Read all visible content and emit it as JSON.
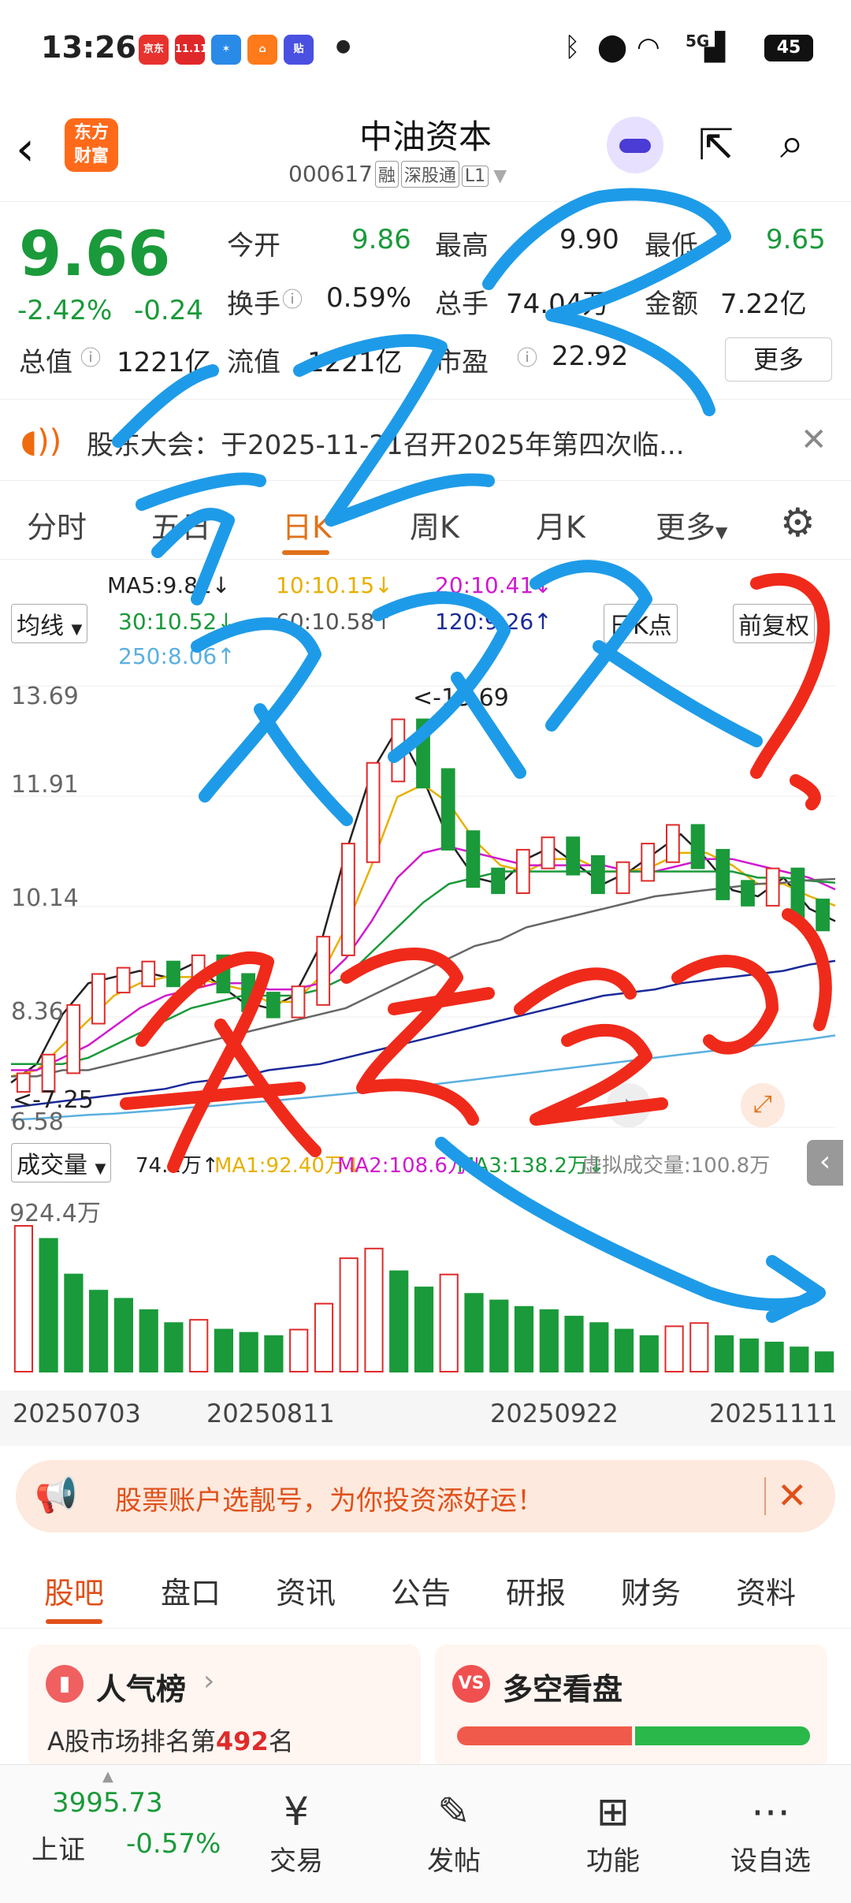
{
  "status_bar": {
    "time": "13:26",
    "apps": [
      "京东秒送",
      "11.11",
      "星",
      "淘",
      "贴"
    ],
    "network": "5G",
    "battery": "45"
  },
  "header": {
    "stock_name": "中油资本",
    "stock_code": "000617",
    "tags": [
      "融",
      "深股通",
      "L1"
    ],
    "logo_text_1": "东方",
    "logo_text_2": "财富"
  },
  "quote": {
    "price": "9.66",
    "pct_change": "-2.42%",
    "change": "-0.24",
    "open_label": "今开",
    "open": "9.86",
    "high_label": "最高",
    "high": "9.90",
    "low_label": "最低",
    "low": "9.65",
    "turnover_label": "换手",
    "turnover": "0.59%",
    "volume_label": "总手",
    "volume": "74.04万",
    "amount_label": "金额",
    "amount": "7.22亿",
    "mktcap_label": "总值",
    "mktcap": "1221亿",
    "float_label": "流值",
    "float_cap": "1221亿",
    "pe_label": "市盈",
    "pe": "22.92",
    "more_label": "更多"
  },
  "notice": {
    "text": "股东大会：于2025-11-21召开2025年第四次临..."
  },
  "k_tabs": [
    "分时",
    "五日",
    "日K",
    "周K",
    "月K",
    "更多"
  ],
  "k_tab_active": 2,
  "indicators": {
    "mode": "均线",
    "ma5": "MA5:9.82↓",
    "ma10": "10:10.15↓",
    "ma20": "20:10.41↓",
    "ma30": "30:10.52↓",
    "ma60": "60:10.58↑",
    "ma120": "120:9.26↑",
    "ma250": "250:8.06↑",
    "period": "日K点",
    "adjust": "前复权"
  },
  "chart_data": {
    "type": "line",
    "title": "",
    "ylim": [
      6.58,
      13.69
    ],
    "y_ticks": [
      "13.69",
      "11.91",
      "10.14",
      "8.36",
      "6.58"
    ],
    "max_marker": "<-13.69",
    "min_marker": "<-7.25",
    "x_labels": [
      "20250703",
      "20250811",
      "20250922",
      "20251111"
    ],
    "series": [
      {
        "name": "MA5",
        "values": [
          7.3,
          7.6,
          8.4,
          8.9,
          9.0,
          9.1,
          9.0,
          9.2,
          8.9,
          8.6,
          8.5,
          8.7,
          9.5,
          11.0,
          12.3,
          13.0,
          12.2,
          11.2,
          10.6,
          10.5,
          10.9,
          11.1,
          10.8,
          10.5,
          10.7,
          11.0,
          11.3,
          10.9,
          10.4,
          10.3,
          10.6,
          10.1,
          9.9
        ]
      },
      {
        "name": "MA10",
        "values": [
          7.4,
          7.5,
          7.9,
          8.3,
          8.7,
          8.9,
          9.0,
          9.0,
          8.9,
          8.8,
          8.6,
          8.6,
          9.0,
          9.8,
          10.8,
          11.9,
          12.1,
          11.8,
          11.2,
          10.8,
          10.7,
          10.9,
          10.9,
          10.7,
          10.7,
          10.8,
          11.0,
          11.0,
          10.8,
          10.5,
          10.5,
          10.3,
          10.15
        ]
      },
      {
        "name": "MA20",
        "values": [
          7.5,
          7.5,
          7.7,
          7.9,
          8.2,
          8.5,
          8.7,
          8.8,
          8.9,
          8.9,
          8.8,
          8.8,
          8.9,
          9.3,
          9.9,
          10.6,
          11.0,
          11.1,
          11.0,
          10.9,
          10.8,
          10.8,
          10.8,
          10.8,
          10.7,
          10.7,
          10.8,
          10.9,
          10.9,
          10.8,
          10.7,
          10.6,
          10.41
        ]
      },
      {
        "name": "MA30",
        "values": [
          7.6,
          7.6,
          7.6,
          7.7,
          7.9,
          8.1,
          8.3,
          8.5,
          8.6,
          8.7,
          8.7,
          8.7,
          8.8,
          9.0,
          9.4,
          9.8,
          10.2,
          10.5,
          10.6,
          10.7,
          10.7,
          10.7,
          10.7,
          10.7,
          10.7,
          10.7,
          10.7,
          10.7,
          10.7,
          10.6,
          10.6,
          10.55,
          10.52
        ]
      },
      {
        "name": "MA60",
        "values": [
          7.4,
          7.4,
          7.5,
          7.5,
          7.6,
          7.7,
          7.8,
          7.9,
          8.0,
          8.1,
          8.2,
          8.3,
          8.4,
          8.5,
          8.7,
          8.9,
          9.1,
          9.3,
          9.5,
          9.6,
          9.8,
          9.9,
          10.0,
          10.1,
          10.2,
          10.3,
          10.35,
          10.4,
          10.45,
          10.5,
          10.52,
          10.56,
          10.58
        ]
      },
      {
        "name": "MA120",
        "values": [
          6.9,
          6.95,
          7.0,
          7.05,
          7.1,
          7.15,
          7.2,
          7.3,
          7.35,
          7.4,
          7.5,
          7.55,
          7.6,
          7.7,
          7.8,
          7.9,
          8.0,
          8.1,
          8.2,
          8.3,
          8.4,
          8.5,
          8.6,
          8.7,
          8.75,
          8.8,
          8.9,
          8.95,
          9.0,
          9.05,
          9.1,
          9.2,
          9.26
        ]
      },
      {
        "name": "MA250",
        "values": [
          6.7,
          6.72,
          6.75,
          6.78,
          6.8,
          6.83,
          6.86,
          6.9,
          6.93,
          6.97,
          7.0,
          7.04,
          7.08,
          7.12,
          7.16,
          7.2,
          7.25,
          7.3,
          7.35,
          7.4,
          7.45,
          7.5,
          7.55,
          7.6,
          7.65,
          7.7,
          7.75,
          7.8,
          7.85,
          7.9,
          7.95,
          8.0,
          8.06
        ]
      }
    ],
    "volume": {
      "max_label": "924.4万",
      "label": "成交量",
      "current": "74.1万↑",
      "ma1": "MA1:92.40万↓",
      "ma2": "MA2:108.6万↓",
      "ma3": "MA3:138.2万↓",
      "virtual": "虚拟成交量:100.8万",
      "values": [
        900,
        820,
        600,
        500,
        450,
        380,
        300,
        320,
        260,
        240,
        220,
        260,
        420,
        700,
        760,
        620,
        520,
        600,
        480,
        440,
        400,
        380,
        340,
        300,
        260,
        220,
        280,
        300,
        220,
        200,
        180,
        150,
        120
      ]
    }
  },
  "banner": {
    "text": "股票账户选靓号，为你投资添好运！"
  },
  "bottom_tabs": [
    "股吧",
    "盘口",
    "资讯",
    "公告",
    "研报",
    "财务",
    "资料"
  ],
  "cards": {
    "popularity_title": "人气榜",
    "popularity_text_prefix": "A股市场排名第",
    "popularity_rank": "492",
    "popularity_text_suffix": "名",
    "duokong_title": "多空看盘"
  },
  "bottom_nav": {
    "index_value": "3995.73",
    "index_name": "上证",
    "index_change": "-0.57%",
    "items": [
      "交易",
      "发帖",
      "功能",
      "设自选"
    ]
  },
  "colors": {
    "up": "#e02a2a",
    "down": "#1a9a3a",
    "accent": "#e0721a",
    "scribble_blue": "#1e9be8",
    "scribble_red": "#f02a1a"
  }
}
